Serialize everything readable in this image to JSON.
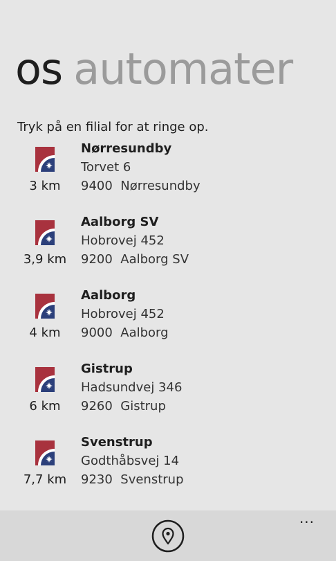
{
  "pivot": {
    "active": "os",
    "inactive": "automater"
  },
  "intro_text": "Tryk på en filial for at ringe op.",
  "branches": [
    {
      "name": "Nørresundby",
      "street": "Torvet 6",
      "postal": "9400",
      "city": "Nørresundby",
      "distance": "3 km"
    },
    {
      "name": "Aalborg SV",
      "street": "Hobrovej 452",
      "postal": "9200",
      "city": "Aalborg SV",
      "distance": "3,9 km"
    },
    {
      "name": "Aalborg",
      "street": "Hobrovej 452",
      "postal": "9000",
      "city": "Aalborg",
      "distance": "4 km"
    },
    {
      "name": "Gistrup",
      "street": "Hadsundvej 346",
      "postal": "9260",
      "city": "Gistrup",
      "distance": "6 km"
    },
    {
      "name": "Svenstrup",
      "street": "Godthåbsvej 14",
      "postal": "9230",
      "city": "Svenstrup",
      "distance": "7,7 km"
    }
  ],
  "appbar": {
    "primary_icon": "map-pin-icon",
    "more_label": "..."
  },
  "colors": {
    "background": "#e6e6e6",
    "appbar": "#d8d8d8",
    "logo_red": "#a8323e",
    "logo_blue": "#2b3f7a",
    "inactive_header": "#9b9b9b"
  }
}
